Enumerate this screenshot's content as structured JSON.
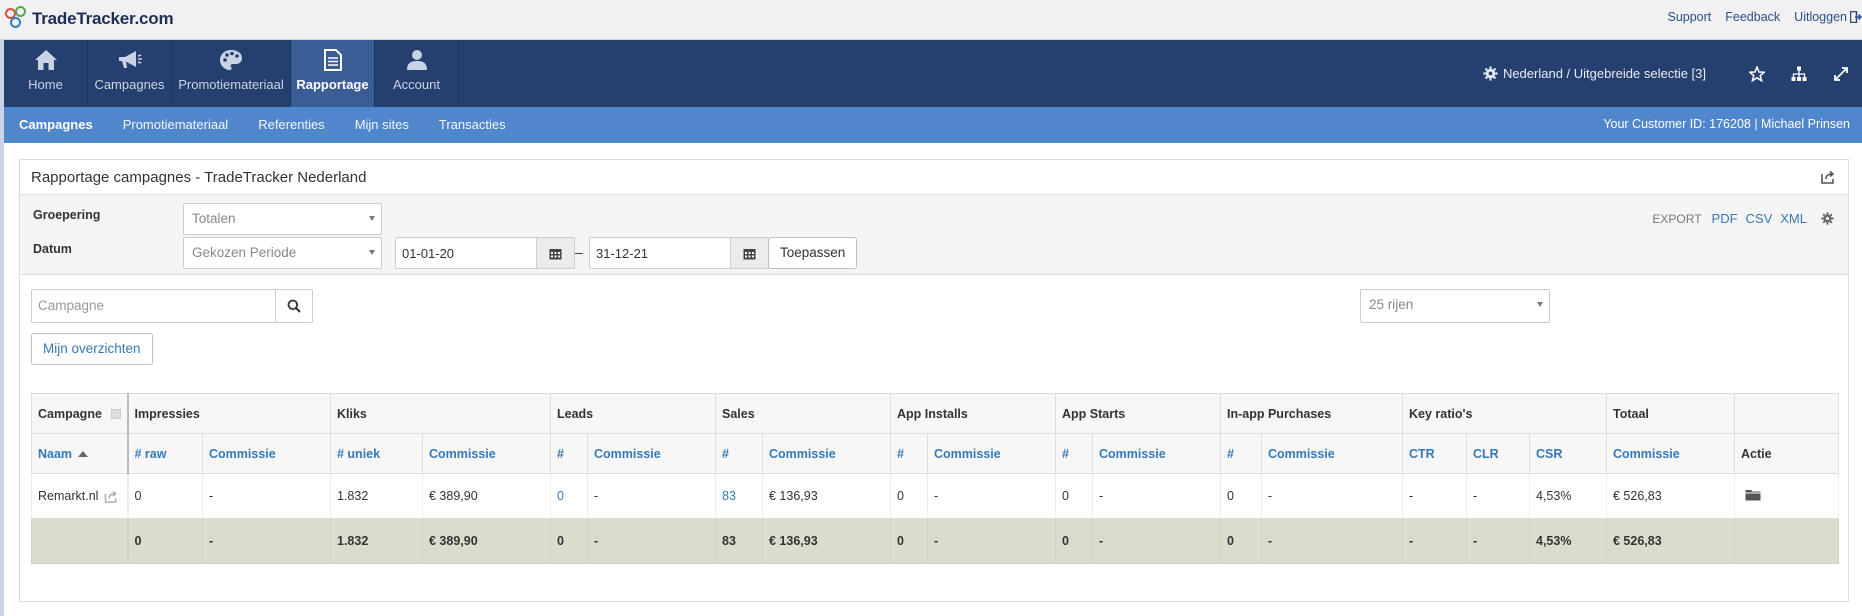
{
  "brand": {
    "name": "TradeTracker.com"
  },
  "toplinks": {
    "support": "Support",
    "feedback": "Feedback",
    "logout": "Uitloggen"
  },
  "mainnav": {
    "items": [
      {
        "label": "Home",
        "icon": "home-icon"
      },
      {
        "label": "Campagnes",
        "icon": "megaphone-icon"
      },
      {
        "label": "Promotiemateriaal",
        "icon": "palette-icon"
      },
      {
        "label": "Rapportage",
        "icon": "document-icon"
      },
      {
        "label": "Account",
        "icon": "user-icon"
      }
    ],
    "active": "Rapportage",
    "region": "Nederland / Uitgebreide selectie [3]"
  },
  "subnav": {
    "items": [
      "Campagnes",
      "Promotiemateriaal",
      "Referenties",
      "Mijn sites",
      "Transacties"
    ],
    "active": "Campagnes",
    "customer": "Your Customer ID: 176208 | Michael Prinsen"
  },
  "panel": {
    "title": "Rapportage campagnes - TradeTracker Nederland"
  },
  "filters": {
    "groupering_label": "Groepering",
    "groupering_value": "Totalen",
    "datum_label": "Datum",
    "datum_value": "Gekozen Periode",
    "date_from": "01-01-20",
    "date_sep": "–",
    "date_to": "31-12-21",
    "apply": "Toepassen",
    "export_label": "EXPORT",
    "export_pdf": "PDF",
    "export_csv": "CSV",
    "export_xml": "XML"
  },
  "search": {
    "placeholder": "Campagne"
  },
  "rows_select": "25 rijen",
  "overviews_button": "Mijn overzichten",
  "table": {
    "groups": [
      "Campagne",
      "Impressies",
      "Kliks",
      "Leads",
      "Sales",
      "App Installs",
      "App Starts",
      "In-app Purchases",
      "Key ratio's",
      "Totaal",
      ""
    ],
    "headers": [
      "Naam",
      "# raw",
      "Commissie",
      "# uniek",
      "Commissie",
      "#",
      "Commissie",
      "#",
      "Commissie",
      "#",
      "Commissie",
      "#",
      "Commissie",
      "#",
      "Commissie",
      "CTR",
      "CLR",
      "CSR",
      "Commissie",
      "Actie"
    ],
    "rows": [
      [
        "Remarkt.nl",
        "0",
        "-",
        "1.832",
        "€ 389,90",
        "0",
        "-",
        "83",
        "€ 136,93",
        "0",
        "-",
        "0",
        "-",
        "0",
        "-",
        "-",
        "-",
        "4,53%",
        "€ 526,83"
      ]
    ],
    "totals": [
      "",
      "0",
      "-",
      "1.832",
      "€ 389,90",
      "0",
      "-",
      "83",
      "€ 136,93",
      "0",
      "-",
      "0",
      "-",
      "0",
      "-",
      "-",
      "-",
      "4,53%",
      "€ 526,83"
    ]
  }
}
